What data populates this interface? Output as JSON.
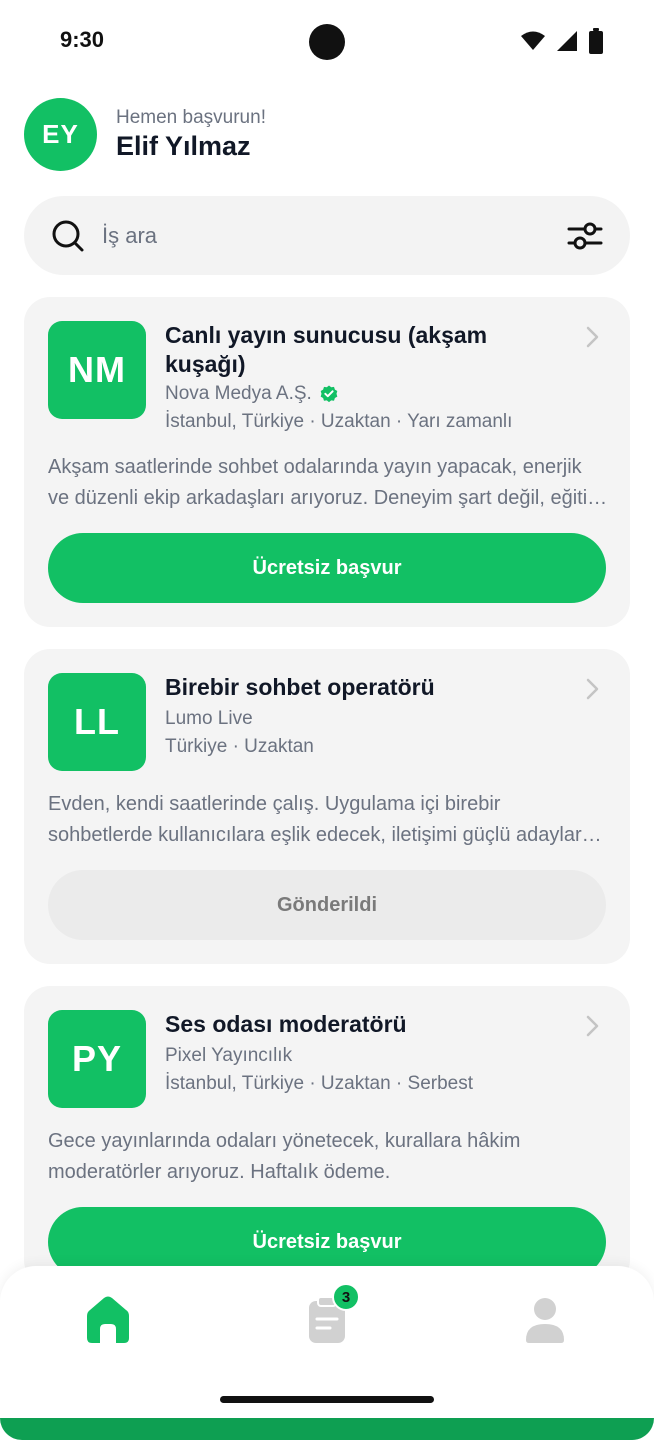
{
  "status_bar": {
    "time": "9:30"
  },
  "header": {
    "avatar_initials": "EY",
    "greeting": "Hemen başvurun!",
    "user_name": "Elif Yılmaz"
  },
  "search": {
    "placeholder": "İş ara"
  },
  "jobs": [
    {
      "logo": "NM",
      "title": "Canlı yayın sunucusu (akşam kuşağı)",
      "company": "Nova Medya A.Ş.",
      "verified": true,
      "meta": "İstanbul, Türkiye · Uzaktan · Yarı zamanlı",
      "description": "Akşam saatlerinde sohbet odalarında yayın yapacak, enerjik ve düzenli ekip arkadaşları arıyoruz. Deneyim şart değil, eğitim verilecektir.",
      "action_label": "Ücretsiz başvur",
      "action_state": "apply"
    },
    {
      "logo": "LL",
      "title": "Birebir sohbet operatörü",
      "company": "Lumo Live",
      "verified": false,
      "meta": "Türkiye · Uzaktan",
      "description": "Evden, kendi saatlerinde çalış. Uygulama içi birebir sohbetlerde kullanıcılara eşlik edecek, iletişimi güçlü adaylar arıyoruz.",
      "action_label": "Gönderildi",
      "action_state": "sent"
    },
    {
      "logo": "PY",
      "title": "Ses odası moderatörü",
      "company": "Pixel Yayıncılık",
      "verified": false,
      "meta": "İstanbul, Türkiye · Uzaktan · Serbest",
      "description": "Gece yayınlarında odaları yönetecek, kurallara hâkim moderatörler arıyoruz. Haftalık ödeme.",
      "action_label": "Ücretsiz başvur",
      "action_state": "apply"
    }
  ],
  "bottom_nav": {
    "items": [
      {
        "icon": "home-icon",
        "active": true
      },
      {
        "icon": "applications-icon",
        "active": false,
        "badge": "3"
      },
      {
        "icon": "profile-icon",
        "active": false
      }
    ]
  },
  "colors": {
    "accent": "#12c064",
    "card_bg": "#f4f4f4",
    "muted_text": "#6b7280",
    "title_text": "#111827"
  }
}
